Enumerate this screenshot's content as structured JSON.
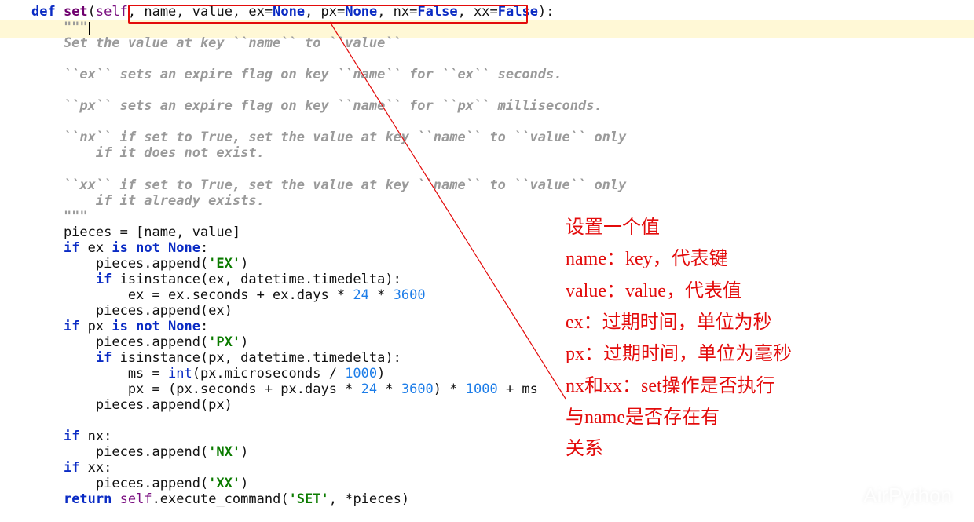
{
  "code": {
    "def": "def ",
    "fn": "set",
    "open": "(",
    "self": "self",
    "params_text": ", name, value, ex=",
    "none1": "None",
    "px_text": ", px=",
    "none2": "None",
    "nx_text": ", nx=",
    "false1": "False",
    "xx_text": ", xx=",
    "false2": "False",
    "close": "):",
    "triple_open": "    \"\"\"",
    "doc1": "    Set the value at key ``name`` to ``value``",
    "doc2": "    ``ex`` sets an expire flag on key ``name`` for ``ex`` seconds.",
    "doc3": "    ``px`` sets an expire flag on key ``name`` for ``px`` milliseconds.",
    "doc4a": "    ``nx`` if set to True, set the value at key ``name`` to ``value`` only",
    "doc4b": "        if it does not exist.",
    "doc5a": "    ``xx`` if set to True, set the value at key ``name`` to ``value`` only",
    "doc5b": "        if it already exists.",
    "triple_close": "    \"\"\"",
    "pieces_line": "    pieces = [name, value]",
    "if1_a": "    ",
    "if1_b": "if",
    "if1_c": " ex ",
    "if1_d": "is not ",
    "if1_e": "None",
    "if1_f": ":",
    "ex1": "        pieces.append(",
    "ex1_str": "'EX'",
    "ex1_c": ")",
    "ex2_a": "        ",
    "ex2_b": "if",
    "ex2_c": " isinstance(ex, datetime.timedelta):",
    "ex3_a": "            ex = ex.seconds + ex.days * ",
    "ex3_n1": "24",
    "ex3_b": " * ",
    "ex3_n2": "3600",
    "ex4": "        pieces.append(ex)",
    "if2_a": "    ",
    "if2_b": "if",
    "if2_c": " px ",
    "if2_d": "is not ",
    "if2_e": "None",
    "if2_f": ":",
    "px1": "        pieces.append(",
    "px1_str": "'PX'",
    "px1_c": ")",
    "px2_a": "        ",
    "px2_b": "if",
    "px2_c": " isinstance(px, datetime.timedelta):",
    "px3_a": "            ms = ",
    "px3_int": "int",
    "px3_b": "(px.microseconds / ",
    "px3_n": "1000",
    "px3_c": ")",
    "px4_a": "            px = (px.seconds + px.days * ",
    "px4_n1": "24",
    "px4_b": " * ",
    "px4_n2": "3600",
    "px4_c": ") * ",
    "px4_n3": "1000",
    "px4_d": " + ms",
    "px5": "        pieces.append(px)",
    "if3_a": "    ",
    "if3_b": "if",
    "if3_c": " nx:",
    "nx1": "        pieces.append(",
    "nx1_str": "'NX'",
    "nx1_c": ")",
    "if4_a": "    ",
    "if4_b": "if",
    "if4_c": " xx:",
    "xx1": "        pieces.append(",
    "xx1_str": "'XX'",
    "xx1_c": ")",
    "ret_a": "    ",
    "ret_b": "return ",
    "ret_c": "self",
    "ret_d": ".execute_command(",
    "ret_str": "'SET'",
    "ret_e": ", *pieces)"
  },
  "annotations": {
    "l1": "设置一个值",
    "l2": "name：key，代表键",
    "l3": "value：value，代表值",
    "l4": "ex：过期时间，单位为秒",
    "l5": "px：过期时间，单位为毫秒",
    "l6": "nx和xx：set操作是否执行",
    "l7": "              与name是否存在有",
    "l8": "              关系"
  },
  "watermark": {
    "text": "AirPython"
  }
}
